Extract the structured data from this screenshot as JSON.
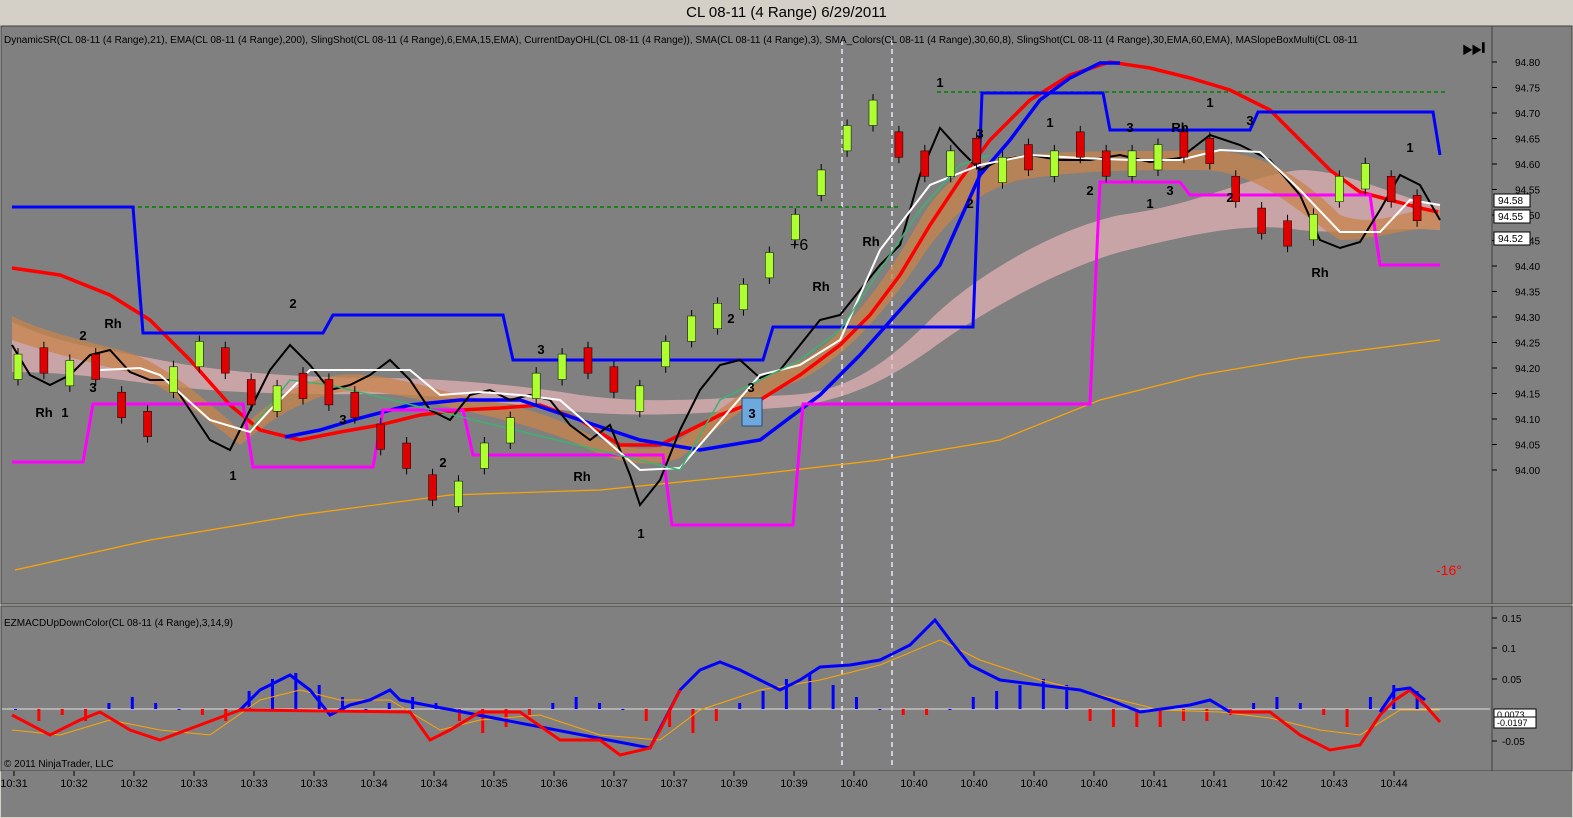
{
  "window": {
    "title": "CL 08-11 (4 Range)  6/29/2011"
  },
  "main_panel": {
    "indicator_legend": "DynamicSR(CL 08-11 (4 Range),21), EMA(CL 08-11 (4 Range),200), SlingShot(CL 08-11 (4 Range),6,EMA,15,EMA), CurrentDayOHL(CL 08-11 (4 Range)), SMA(CL 08-11 (4 Range),3), SMA_Colors(CL 08-11 (4 Range),30,60,8), SlingShot(CL 08-11 (4 Range),30,EMA,60,EMA), MASlopeBoxMulti(CL 08-11",
    "slope_label": "-16°",
    "annotation_plus": "+6",
    "price_ticks": [
      "94.80",
      "94.75",
      "94.70",
      "94.65",
      "94.60",
      "94.55",
      "94.50",
      "94.45",
      "94.40",
      "94.35",
      "94.30",
      "94.25",
      "94.20",
      "94.15",
      "94.10",
      "94.05",
      "94.00"
    ],
    "price_markers": [
      "94.58",
      "94.55",
      "94.52"
    ],
    "labels": [
      {
        "t": "Rh",
        "p": "a"
      },
      {
        "t": "1",
        "p": "a"
      },
      {
        "t": "2",
        "p": "a"
      },
      {
        "t": "Rh",
        "p": "a"
      },
      {
        "t": "3",
        "p": "a"
      },
      {
        "t": "1",
        "p": "a"
      },
      {
        "t": "2",
        "p": "a"
      },
      {
        "t": "3",
        "p": "a"
      },
      {
        "t": "2",
        "p": "a"
      },
      {
        "t": "3",
        "p": "a"
      },
      {
        "t": "Rh",
        "p": "a"
      },
      {
        "t": "1",
        "p": "a"
      },
      {
        "t": "2",
        "p": "a"
      },
      {
        "t": "3",
        "p": "a"
      },
      {
        "t": "Rh",
        "p": "a"
      },
      {
        "t": "Rh",
        "p": "a"
      },
      {
        "t": "1",
        "p": "a"
      },
      {
        "t": "3",
        "p": "a"
      },
      {
        "t": "2",
        "p": "a"
      },
      {
        "t": "1",
        "p": "a"
      },
      {
        "t": "2",
        "p": "a"
      },
      {
        "t": "3",
        "p": "a"
      },
      {
        "t": "1",
        "p": "a"
      },
      {
        "t": "3",
        "p": "a"
      },
      {
        "t": "Rh",
        "p": "a"
      },
      {
        "t": "1",
        "p": "a"
      },
      {
        "t": "3",
        "p": "a"
      },
      {
        "t": "2",
        "p": "a"
      },
      {
        "t": "Rh",
        "p": "a"
      },
      {
        "t": "1",
        "p": "a"
      }
    ]
  },
  "lower_panel": {
    "indicator_legend": "EZMACDUpDownColor(CL 08-11 (4 Range),3,14,9)",
    "ticks": [
      "0.15",
      "0.1",
      "0.05",
      "-0.05"
    ],
    "value_markers": [
      "0.0073",
      "-0.0197"
    ]
  },
  "time_axis": {
    "labels": [
      "10:31",
      "10:32",
      "10:32",
      "10:33",
      "10:33",
      "10:33",
      "10:34",
      "10:34",
      "10:35",
      "10:36",
      "10:37",
      "10:37",
      "10:39",
      "10:39",
      "10:40",
      "10:40",
      "10:40",
      "10:40",
      "10:40",
      "10:41",
      "10:41",
      "10:42",
      "10:43",
      "10:44"
    ]
  },
  "footer": {
    "copyright": "© 2011 NinjaTrader, LLC"
  },
  "colors": {
    "panel_bg": "#808080",
    "window_bg": "#d4d0c8",
    "candle_up": "#adff2f",
    "candle_down": "#e00000",
    "dynamic_sr_upper": "#0000ff",
    "dynamic_sr_lower": "#ff00ff",
    "ema200": "#ffa500",
    "slingshot_fast": "#ff0000",
    "current_day_open": "#008000",
    "sma3": "#000000",
    "macd_up": "#0000ff",
    "macd_down": "#ff0000"
  },
  "chart_data": [
    {
      "type": "candlestick",
      "title": "CL 08-11 (4 Range)  6/29/2011",
      "ylim": [
        94.0,
        94.8
      ],
      "x": [
        "10:31",
        "10:32",
        "10:32",
        "10:33",
        "10:33",
        "10:33",
        "10:34",
        "10:34",
        "10:35",
        "10:36",
        "10:37",
        "10:37",
        "10:39",
        "10:39",
        "10:40",
        "10:40",
        "10:40",
        "10:40",
        "10:40",
        "10:41",
        "10:41",
        "10:42",
        "10:43",
        "10:44"
      ],
      "close": [
        94.34,
        94.31,
        94.33,
        94.3,
        94.24,
        94.21,
        94.32,
        94.36,
        94.31,
        94.26,
        94.29,
        94.27,
        94.26,
        94.24,
        94.19,
        94.16,
        94.11,
        94.14,
        94.2,
        94.24,
        94.31,
        94.34,
        94.31,
        94.28,
        94.29,
        94.36,
        94.4,
        94.42,
        94.45,
        94.5,
        94.56,
        94.63,
        94.7,
        94.74,
        94.65,
        94.62,
        94.66,
        94.64,
        94.65,
        94.63,
        94.66,
        94.65,
        94.62,
        94.66,
        94.67,
        94.65,
        94.64,
        94.58,
        94.53,
        94.51,
        94.56,
        94.62,
        94.64,
        94.58,
        94.55
      ],
      "series": [
        {
          "name": "DynamicSR upper",
          "values": [
            94.57,
            94.57,
            94.57,
            94.57,
            94.57,
            94.37,
            94.37,
            94.37,
            94.4,
            94.4,
            94.4,
            94.35,
            94.35,
            94.35,
            94.35,
            94.35,
            94.35,
            94.38,
            94.38,
            94.38,
            94.38,
            94.38,
            94.75,
            94.75,
            94.75,
            94.7,
            94.7,
            94.72,
            94.72,
            94.72
          ]
        },
        {
          "name": "DynamicSR lower",
          "values": [
            94.17,
            94.17,
            94.26,
            94.26,
            94.26,
            94.16,
            94.16,
            94.16,
            94.23,
            94.23,
            94.18,
            94.18,
            94.18,
            94.07,
            94.07,
            94.07,
            94.26,
            94.26,
            94.26,
            94.26,
            94.26,
            94.62,
            94.62,
            94.59,
            94.59,
            94.59,
            94.59,
            94.48,
            94.48,
            94.48
          ]
        },
        {
          "name": "EMA 200",
          "values": [
            94.0,
            94.03,
            94.06,
            94.08,
            94.1,
            94.11,
            94.13,
            94.14,
            94.16,
            94.17,
            94.19,
            94.2,
            94.22,
            94.24,
            94.26,
            94.28,
            94.3,
            94.32,
            94.34,
            94.36
          ]
        },
        {
          "name": "SlingShot fast",
          "values": [
            94.47,
            94.43,
            94.38,
            94.3,
            94.24,
            94.2,
            94.22,
            94.25,
            94.28,
            94.27,
            94.25,
            94.22,
            94.19,
            94.18,
            94.2,
            94.24,
            94.3,
            94.38,
            94.48,
            94.6,
            94.68,
            94.74,
            94.78,
            94.79,
            94.77,
            94.74,
            94.68,
            94.62,
            94.58,
            94.56
          ]
        }
      ]
    },
    {
      "type": "bar",
      "title": "EZMACDUpDownColor(CL 08-11 (4 Range),3,14,9)",
      "ylim": [
        -0.06,
        0.16
      ],
      "values": [
        0.0,
        -0.02,
        -0.01,
        -0.02,
        0.01,
        0.02,
        0.01,
        0.0,
        -0.01,
        -0.02,
        0.03,
        0.05,
        0.06,
        0.04,
        0.02,
        0.0,
        0.01,
        0.02,
        0.01,
        -0.02,
        -0.04,
        -0.03,
        -0.01,
        0.01,
        0.02,
        0.01,
        0.0,
        -0.02,
        -0.03,
        -0.04,
        -0.02,
        0.01,
        0.03,
        0.05,
        0.06,
        0.04,
        0.02,
        0.0,
        -0.01,
        -0.01,
        0.0,
        0.02,
        0.03,
        0.04,
        0.05,
        0.04,
        -0.02,
        -0.03,
        -0.03,
        -0.03,
        -0.02,
        -0.02,
        -0.01,
        0.01,
        0.02,
        0.01,
        -0.01,
        -0.03,
        0.02,
        0.04,
        0.03
      ]
    }
  ]
}
